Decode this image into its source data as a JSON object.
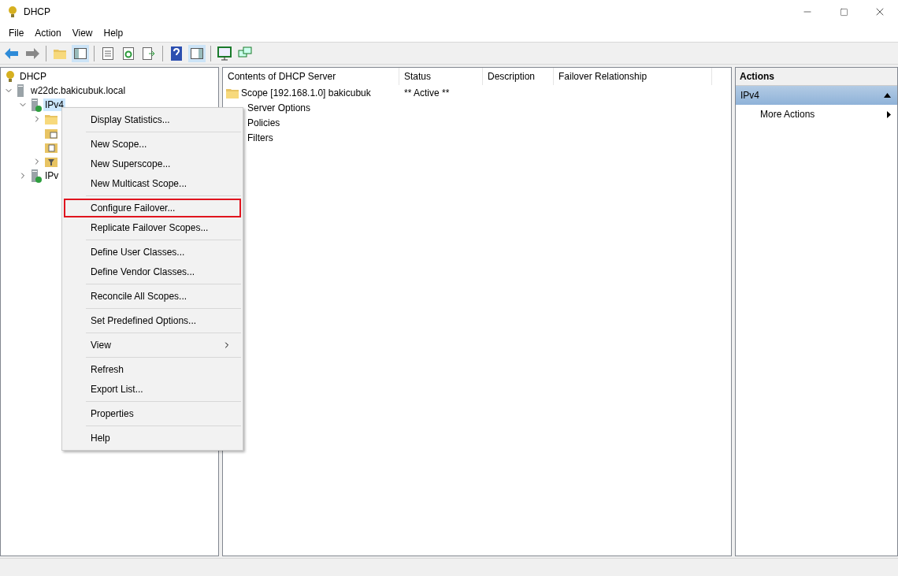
{
  "window": {
    "title": "DHCP"
  },
  "menu_bar": [
    "File",
    "Action",
    "View",
    "Help"
  ],
  "tree": [
    {
      "label": "DHCP",
      "kind": "root",
      "selected": false,
      "children": [
        {
          "label": "w22dc.bakicubuk.local",
          "kind": "server",
          "expanded": true,
          "selected": false,
          "children": [
            {
              "label": "IPv4",
              "kind": "ipv",
              "expanded": true,
              "selected": true,
              "children": [
                {
                  "kind": "folder",
                  "expanded": false
                },
                {
                  "kind": "options"
                },
                {
                  "kind": "policy"
                },
                {
                  "kind": "filter",
                  "expanded": false
                }
              ]
            },
            {
              "label": "IPv",
              "kind": "ipv",
              "expanded": false,
              "selected": false
            }
          ]
        }
      ]
    }
  ],
  "table": {
    "columns": [
      "Contents of DHCP Server",
      "Status",
      "Description",
      "Failover Relationship"
    ],
    "rows": [
      {
        "name": "Scope [192.168.1.0] bakicubuk",
        "status": "** Active **",
        "icon": true
      },
      {
        "name": "Server Options",
        "icon": false
      },
      {
        "name": "Policies",
        "icon": false
      },
      {
        "name": "Filters",
        "icon": false
      }
    ]
  },
  "actions": {
    "title": "Actions",
    "section": "IPv4",
    "items": [
      "More Actions"
    ]
  },
  "context_menu": [
    [
      {
        "label": "Display Statistics...",
        "highlighted": false
      }
    ],
    [
      {
        "label": "New Scope...",
        "highlighted": false
      },
      {
        "label": "New Superscope...",
        "highlighted": false
      },
      {
        "label": "New Multicast Scope...",
        "highlighted": false
      }
    ],
    [
      {
        "label": "Configure Failover...",
        "highlighted": true
      },
      {
        "label": "Replicate Failover Scopes...",
        "highlighted": false
      }
    ],
    [
      {
        "label": "Define User Classes...",
        "highlighted": false
      },
      {
        "label": "Define Vendor Classes...",
        "highlighted": false
      }
    ],
    [
      {
        "label": "Reconcile All Scopes...",
        "highlighted": false
      }
    ],
    [
      {
        "label": "Set Predefined Options...",
        "highlighted": false
      }
    ],
    [
      {
        "label": "View",
        "highlighted": false,
        "submenu": true
      }
    ],
    [
      {
        "label": "Refresh",
        "highlighted": false
      },
      {
        "label": "Export List...",
        "highlighted": false
      }
    ],
    [
      {
        "label": "Properties",
        "highlighted": false
      }
    ],
    [
      {
        "label": "Help",
        "highlighted": false
      }
    ]
  ]
}
